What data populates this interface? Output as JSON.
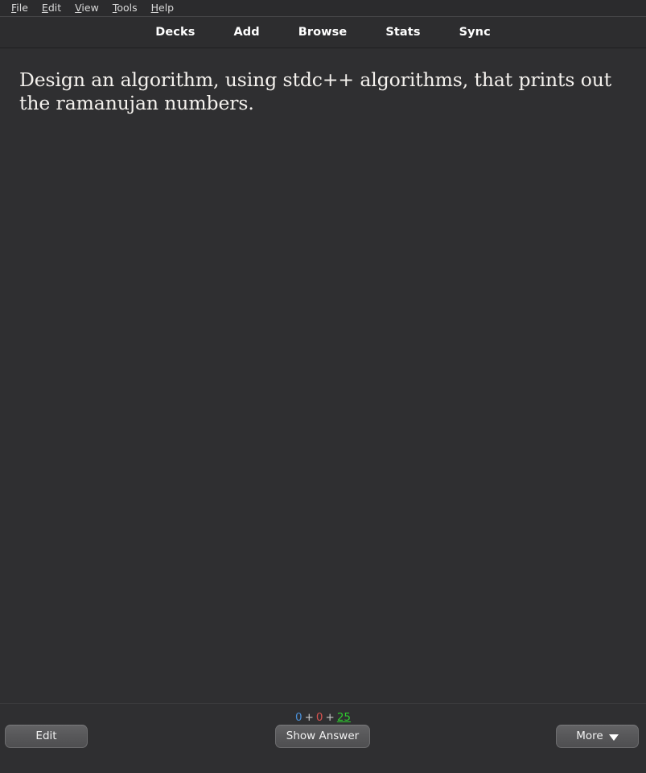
{
  "menubar": {
    "items": [
      {
        "name": "file",
        "accel": "F",
        "rest": "ile"
      },
      {
        "name": "edit",
        "accel": "E",
        "rest": "dit"
      },
      {
        "name": "view",
        "accel": "V",
        "rest": "iew"
      },
      {
        "name": "tools",
        "accel": "T",
        "rest": "ools"
      },
      {
        "name": "help",
        "accel": "H",
        "rest": "elp"
      }
    ]
  },
  "topnav": {
    "links": [
      {
        "label": "Decks"
      },
      {
        "label": "Add"
      },
      {
        "label": "Browse"
      },
      {
        "label": "Stats"
      },
      {
        "label": "Sync"
      }
    ]
  },
  "card": {
    "question": "Design an algorithm, using stdc++ algorithms, that prints out the ramanujan numbers."
  },
  "counts": {
    "new": "0",
    "separator1": "+",
    "learning": "0",
    "separator2": "+",
    "due": "25",
    "colors": {
      "new": "#4a90d9",
      "learning": "#d9534f",
      "due": "#2ecc2e"
    }
  },
  "buttons": {
    "edit": "Edit",
    "show_answer": "Show Answer",
    "more": "More",
    "more_caret_icon": "chevron-down-icon"
  },
  "theme": {
    "background": "#2f2f31",
    "menubar_background": "#2b2b2d",
    "topnav_background": "#2d2d2f",
    "button_background": "#58585a",
    "text": "#f5f2ee"
  }
}
